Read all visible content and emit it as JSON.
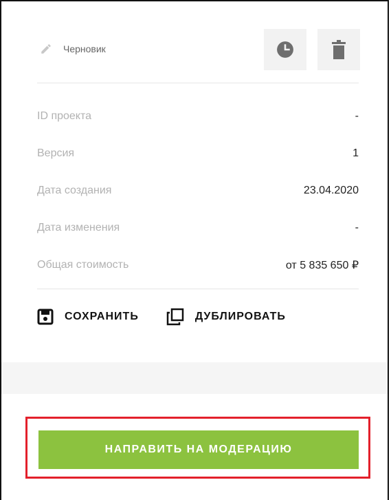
{
  "header": {
    "status_label": "Черновик",
    "icons": {
      "status": "pencil-icon",
      "history": "clock-icon",
      "delete": "trash-icon"
    }
  },
  "info": {
    "rows": [
      {
        "label": "ID проекта",
        "value": "-"
      },
      {
        "label": "Версия",
        "value": "1"
      },
      {
        "label": "Дата создания",
        "value": "23.04.2020"
      },
      {
        "label": "Дата изменения",
        "value": "-"
      },
      {
        "label": "Общая стоимость",
        "value": "от 5 835 650 ₽"
      }
    ]
  },
  "actions": {
    "save_label": "СОХРАНИТЬ",
    "duplicate_label": "ДУБЛИРОВАТЬ",
    "icons": {
      "save": "floppy-disk-icon",
      "duplicate": "copy-icon"
    }
  },
  "submit": {
    "label": "НАПРАВИТЬ НА МОДЕРАЦИЮ",
    "button_color": "#8cc23f",
    "highlight_color": "#e3202b"
  }
}
